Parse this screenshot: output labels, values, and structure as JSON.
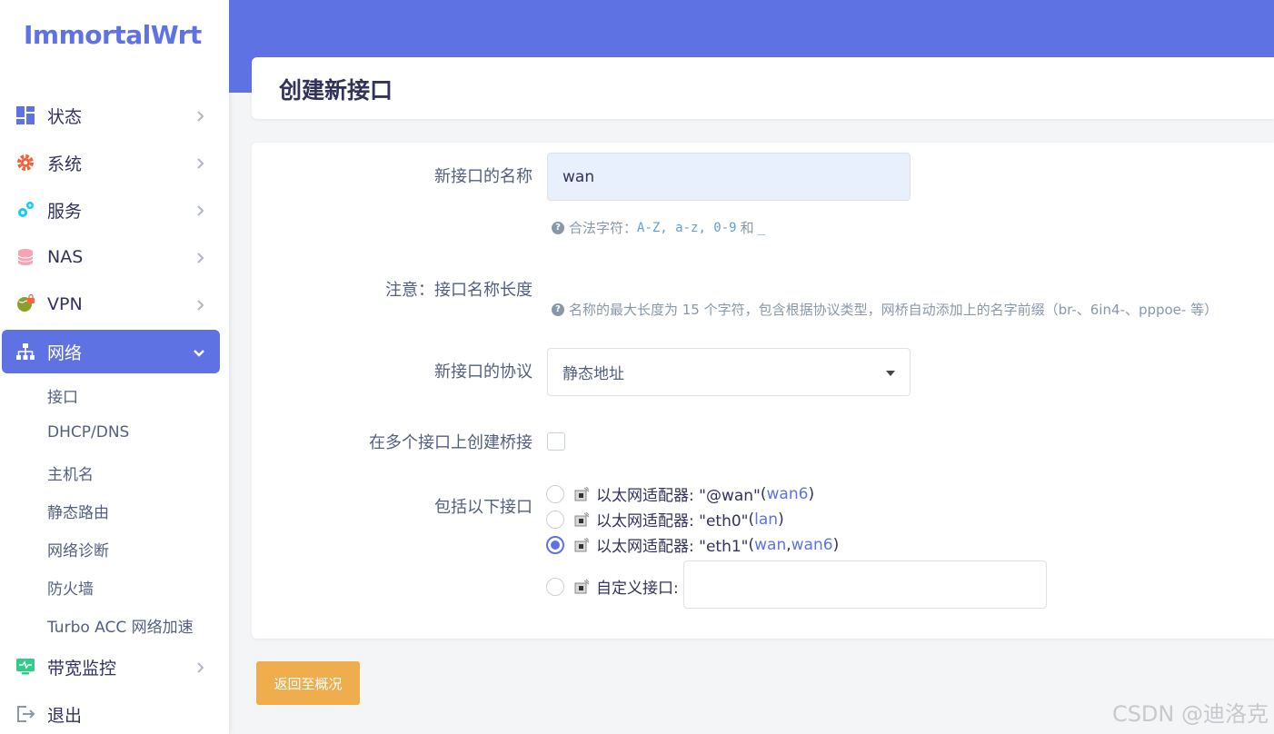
{
  "app": {
    "logo": "ImmortalWrt"
  },
  "sidebar": {
    "items": [
      {
        "label": "状态",
        "icon": "dashboard-icon"
      },
      {
        "label": "系统",
        "icon": "gear-icon"
      },
      {
        "label": "服务",
        "icon": "gears-icon"
      },
      {
        "label": "NAS",
        "icon": "database-icon"
      },
      {
        "label": "VPN",
        "icon": "globe-lock-icon"
      },
      {
        "label": "网络",
        "icon": "sitemap-icon",
        "active": true
      },
      {
        "label": "带宽监控",
        "icon": "monitor-icon"
      },
      {
        "label": "退出",
        "icon": "logout-icon"
      }
    ],
    "network_sub": [
      "接口",
      "DHCP/DNS",
      "主机名",
      "静态路由",
      "网络诊断",
      "防火墙",
      "Turbo ACC 网络加速"
    ]
  },
  "page": {
    "title": "创建新接口"
  },
  "form": {
    "name_label": "新接口的名称",
    "name_value": "wan",
    "name_hint_prefix": "合法字符：",
    "name_hint_chars": "A-Z, a-z, 0-9",
    "name_hint_and": "和",
    "name_hint_underscore": "_",
    "note_label": "注意：接口名称长度",
    "note_hint": "名称的最大长度为 15 个字符，包含根据协议类型，网桥自动添加上的名字前缀（br-、6in4-、pppoe- 等）",
    "protocol_label": "新接口的协议",
    "protocol_value": "静态地址",
    "bridge_label": "在多个接口上创建桥接",
    "include_label": "包括以下接口",
    "interfaces": [
      {
        "text": "以太网适配器: \"@wan\"",
        "open": " (",
        "links": [
          "wan6"
        ],
        "close": ")",
        "checked": false
      },
      {
        "text": "以太网适配器: \"eth0\"",
        "open": " (",
        "links": [
          "lan"
        ],
        "close": ")",
        "checked": false
      },
      {
        "text": "以太网适配器: \"eth1\"",
        "open": " (",
        "links": [
          "wan",
          "wan6"
        ],
        "close": ")",
        "checked": true
      }
    ],
    "link_sep": ", ",
    "custom_label": "自定义接口:"
  },
  "buttons": {
    "back": "返回至概况"
  },
  "watermark": "CSDN @迪洛克",
  "colors": {
    "primary": "#5e72e4",
    "warning": "#f0ad4e",
    "input_fill": "#e8f0fe"
  }
}
